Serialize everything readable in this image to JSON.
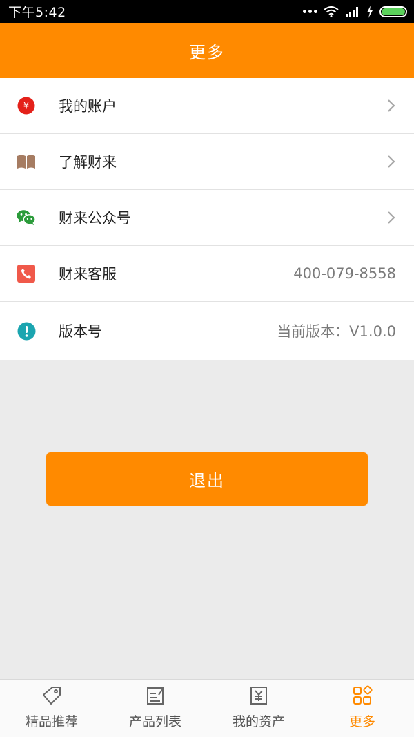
{
  "status_bar": {
    "time": "下午5:42"
  },
  "header": {
    "title": "更多"
  },
  "menu": {
    "items": [
      {
        "label": "我的账户",
        "icon": "yen-circle-icon"
      },
      {
        "label": "了解财来",
        "icon": "book-icon"
      },
      {
        "label": "财来公众号",
        "icon": "wechat-icon"
      },
      {
        "label": "财来客服",
        "icon": "phone-icon",
        "value": "400-079-8558"
      },
      {
        "label": "版本号",
        "icon": "exclamation-circle-icon",
        "value": "当前版本：V1.0.0"
      }
    ]
  },
  "logout": {
    "label": "退出"
  },
  "tabs": [
    {
      "label": "精品推荐",
      "icon": "tag-icon"
    },
    {
      "label": "产品列表",
      "icon": "edit-list-icon"
    },
    {
      "label": "我的资产",
      "icon": "yen-receipt-icon"
    },
    {
      "label": "更多",
      "icon": "grid-diamond-icon",
      "active": true
    }
  ],
  "colors": {
    "accent": "#ff8a00",
    "red": "#e4211a",
    "green": "#2b9b3a",
    "teal": "#1ba5b0",
    "brown": "#a67c62",
    "coral": "#f0594a"
  }
}
